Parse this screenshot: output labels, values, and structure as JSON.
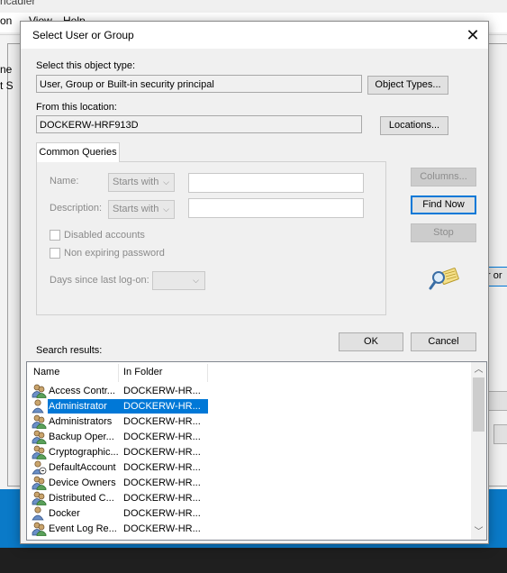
{
  "background": {
    "title_fragment": "hcadler",
    "menu": [
      "on",
      "View",
      "Help"
    ],
    "left_fragments": [
      "ne",
      "t S"
    ],
    "right_button_fragment": "r or"
  },
  "dialog": {
    "title": "Select User or Group",
    "object_type_label": "Select this object type:",
    "object_type_value": "User, Group or Built-in security principal",
    "object_types_button": "Object Types...",
    "location_label": "From this location:",
    "location_value": "DOCKERW-HRF913D",
    "locations_button": "Locations...",
    "tab_label": "Common Queries",
    "name_label": "Name:",
    "description_label": "Description:",
    "starts_with": "Starts with",
    "disabled_accounts": "Disabled accounts",
    "non_expiring_password": "Non expiring password",
    "days_since_logon": "Days since last log-on:",
    "columns_button": "Columns...",
    "find_now_button": "Find Now",
    "stop_button": "Stop",
    "ok_button": "OK",
    "cancel_button": "Cancel",
    "search_results_label": "Search results:"
  },
  "results": {
    "columns": [
      "Name",
      "In Folder"
    ],
    "rows": [
      {
        "name": "Access Contr...",
        "folder": "DOCKERW-HR...",
        "icon": "group-icon",
        "selected": false
      },
      {
        "name": "Administrator",
        "folder": "DOCKERW-HR...",
        "icon": "user-icon",
        "selected": true
      },
      {
        "name": "Administrators",
        "folder": "DOCKERW-HR...",
        "icon": "group-icon",
        "selected": false
      },
      {
        "name": "Backup Oper...",
        "folder": "DOCKERW-HR...",
        "icon": "group-icon",
        "selected": false
      },
      {
        "name": "Cryptographic...",
        "folder": "DOCKERW-HR...",
        "icon": "group-icon",
        "selected": false
      },
      {
        "name": "DefaultAccount",
        "folder": "DOCKERW-HR...",
        "icon": "disabled-user-icon",
        "selected": false
      },
      {
        "name": "Device Owners",
        "folder": "DOCKERW-HR...",
        "icon": "group-icon",
        "selected": false
      },
      {
        "name": "Distributed C...",
        "folder": "DOCKERW-HR...",
        "icon": "group-icon",
        "selected": false
      },
      {
        "name": "Docker",
        "folder": "DOCKERW-HR...",
        "icon": "user-icon",
        "selected": false
      },
      {
        "name": "Event Log Re...",
        "folder": "DOCKERW-HR...",
        "icon": "group-icon",
        "selected": false
      }
    ]
  },
  "colors": {
    "selection": "#0078d7",
    "taskbar_blue": "#0a7ac8"
  }
}
